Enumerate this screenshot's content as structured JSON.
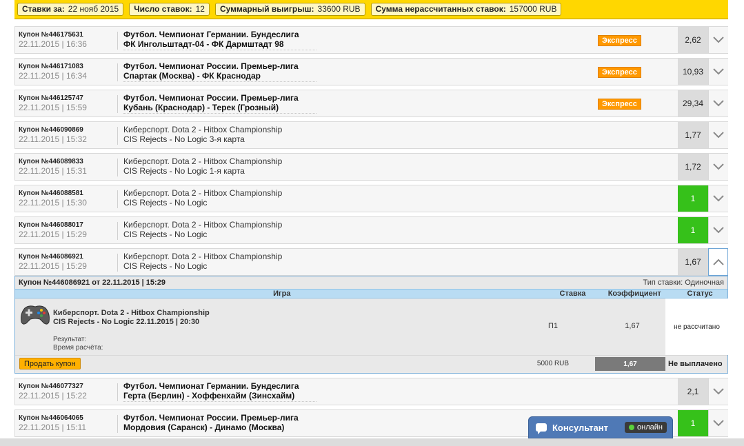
{
  "summary": {
    "bets_for_label": "Ставки за:",
    "bets_for_value": "22 нояб 2015",
    "count_label": "Число ставок:",
    "count_value": "12",
    "total_win_label": "Суммарный выигрыш:",
    "total_win_value": "33600 RUB",
    "unsettled_label": "Сумма нерассчитанных ставок:",
    "unsettled_value": "157000 RUB"
  },
  "coupons": [
    {
      "id": "Купон №446175631",
      "date": "22.11.2015 | 16:36",
      "league": "Футбол. Чемпионат Германии. Бундеслига",
      "match": "ФК Ингольштадт-04 - ФК Дармштадт 98",
      "badge": "Экспресс",
      "odds": "2,62",
      "status": "pending"
    },
    {
      "id": "Купон №446171083",
      "date": "22.11.2015 | 16:34",
      "league": "Футбол. Чемпионат России. Премьер-лига",
      "match": "Спартак (Москва) - ФК Краснодар",
      "badge": "Экспресс",
      "odds": "10,93",
      "status": "pending"
    },
    {
      "id": "Купон №446125747",
      "date": "22.11.2015 | 15:59",
      "league": "Футбол. Чемпионат России. Премьер-лига",
      "match": "Кубань (Краснодар) - Терек (Грозный)",
      "badge": "Экспресс",
      "odds": "29,34",
      "status": "pending"
    },
    {
      "id": "Купон №446090869",
      "date": "22.11.2015 | 15:32",
      "league": "Киберспорт. Dota 2 - Hitbox Championship",
      "match": "CIS Rejects - No Logic 3-я карта",
      "badge": "",
      "odds": "1,77",
      "status": "pending"
    },
    {
      "id": "Купон №446089833",
      "date": "22.11.2015 | 15:31",
      "league": "Киберспорт. Dota 2 - Hitbox Championship",
      "match": "CIS Rejects - No Logic 1-я карта",
      "badge": "",
      "odds": "1,72",
      "status": "pending"
    },
    {
      "id": "Купон №446088581",
      "date": "22.11.2015 | 15:30",
      "league": "Киберспорт. Dota 2 - Hitbox Championship",
      "match": "CIS Rejects - No Logic",
      "badge": "",
      "odds": "1",
      "status": "win"
    },
    {
      "id": "Купон №446088017",
      "date": "22.11.2015 | 15:29",
      "league": "Киберспорт. Dota 2 - Hitbox Championship",
      "match": "CIS Rejects - No Logic",
      "badge": "",
      "odds": "1",
      "status": "win"
    },
    {
      "id": "Купон №446086921",
      "date": "22.11.2015 | 15:29",
      "league": "Киберспорт. Dota 2 - Hitbox Championship",
      "match": "CIS Rejects - No Logic",
      "badge": "",
      "odds": "1,67",
      "status": "pending",
      "expanded": true
    }
  ],
  "detail": {
    "header": "Купон №446086921 от 22.11.2015 | 15:29",
    "bet_type": "Тип ставки: Одиночная",
    "columns": {
      "game": "Игра",
      "stake": "Ставка",
      "coef": "Коэффициент",
      "status": "Статус"
    },
    "game_line1": "Киберспорт. Dota 2 - Hitbox Championship",
    "game_line2": "CIS Rejects - No Logic 22.11.2015 | 20:30",
    "result_label": "Результат:",
    "calc_time_label": "Время расчёта:",
    "bet": "П1",
    "coefficient": "1,67",
    "status": "не рассчитано",
    "sell_button": "Продать купон",
    "stake_amount": "5000 RUB",
    "total_coef": "1,67",
    "payout_status": "Не выплачено"
  },
  "coupons_after": [
    {
      "id": "Купон №446077327",
      "date": "22.11.2015 | 15:22",
      "league": "Футбол. Чемпионат Германии. Бундеслига",
      "match": "Герта (Берлин) - Хоффенхайм (Зинсхайм)",
      "odds": "2,1",
      "status": "pending"
    },
    {
      "id": "Купон №446064065",
      "date": "22.11.2015 | 15:11",
      "league": "Футбол. Чемпионат России. Премьер-лига",
      "match": "Мордовия (Саранск) - Динамо (Москва)",
      "odds": "1",
      "status": "win"
    }
  ],
  "consultant": {
    "label": "Консультант",
    "status": "онлайн"
  },
  "colors": {
    "accent_yellow": "#ffd700",
    "win_green": "#36c11a",
    "express_orange": "#ff9900",
    "panel_blue": "#b9dcf3"
  }
}
